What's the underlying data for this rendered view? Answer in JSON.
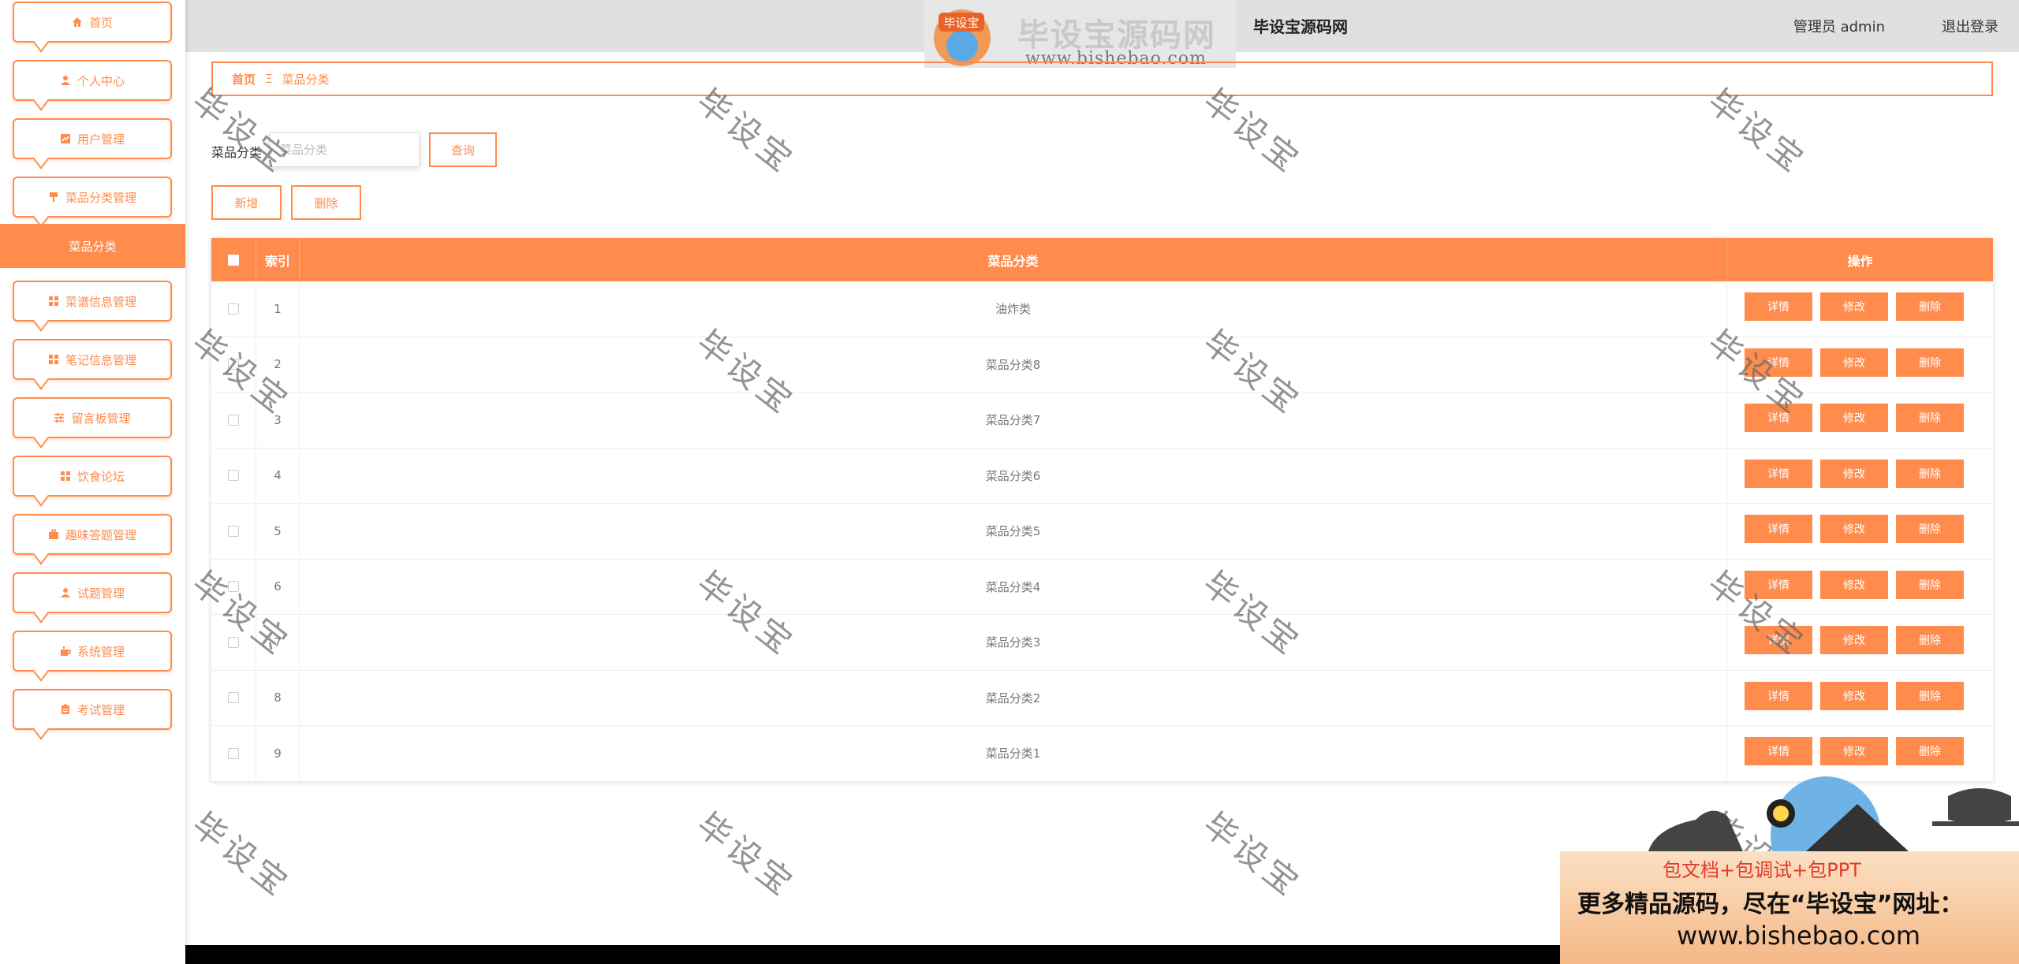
{
  "header": {
    "title": "毕设宝源码网",
    "user": "管理员 admin",
    "logout": "退出登录"
  },
  "logo": {
    "badge": "毕设宝",
    "name": "毕设宝源码网",
    "url": "www.bishebao.com"
  },
  "sidebar": {
    "items": [
      {
        "label": "首页",
        "icon": "home-icon"
      },
      {
        "label": "个人中心",
        "icon": "user-icon"
      },
      {
        "label": "用户管理",
        "icon": "chart-icon"
      },
      {
        "label": "菜品分类管理",
        "icon": "pin-icon"
      },
      {
        "label": "菜谱信息管理",
        "icon": "grid-icon"
      },
      {
        "label": "笔记信息管理",
        "icon": "grid-icon"
      },
      {
        "label": "留言板管理",
        "icon": "sliders-icon"
      },
      {
        "label": "饮食论坛",
        "icon": "grid-icon"
      },
      {
        "label": "趣味答题管理",
        "icon": "briefcase-icon"
      },
      {
        "label": "试题管理",
        "icon": "user-icon"
      },
      {
        "label": "系统管理",
        "icon": "cup-icon"
      },
      {
        "label": "考试管理",
        "icon": "clipboard-icon"
      }
    ],
    "active_sub": "菜品分类"
  },
  "breadcrumb": {
    "home": "首页",
    "sep": "Ξ",
    "current": "菜品分类"
  },
  "search": {
    "label": "菜品分类",
    "placeholder": "菜品分类",
    "button": "查询"
  },
  "toolbar": {
    "add": "新增",
    "delete": "删除"
  },
  "table": {
    "headers": {
      "index": "索引",
      "category": "菜品分类",
      "actions": "操作"
    },
    "rows": [
      {
        "index": "1",
        "category": "油炸类"
      },
      {
        "index": "2",
        "category": "菜品分类8"
      },
      {
        "index": "3",
        "category": "菜品分类7"
      },
      {
        "index": "4",
        "category": "菜品分类6"
      },
      {
        "index": "5",
        "category": "菜品分类5"
      },
      {
        "index": "6",
        "category": "菜品分类4"
      },
      {
        "index": "7",
        "category": "菜品分类3"
      },
      {
        "index": "8",
        "category": "菜品分类2"
      },
      {
        "index": "9",
        "category": "菜品分类1"
      }
    ],
    "actions": {
      "detail": "详情",
      "edit": "修改",
      "delete": "删除"
    }
  },
  "watermark": "毕设宝",
  "promo": {
    "line1": "包文档+包调试+包PPT",
    "line2": "更多精品源码，尽在“毕设宝”网址：",
    "line3": "www.bishebao.com"
  },
  "colors": {
    "accent": "#ff8c4d",
    "header_bg": "#e0e0e0",
    "bottom_bar": "#000000"
  }
}
